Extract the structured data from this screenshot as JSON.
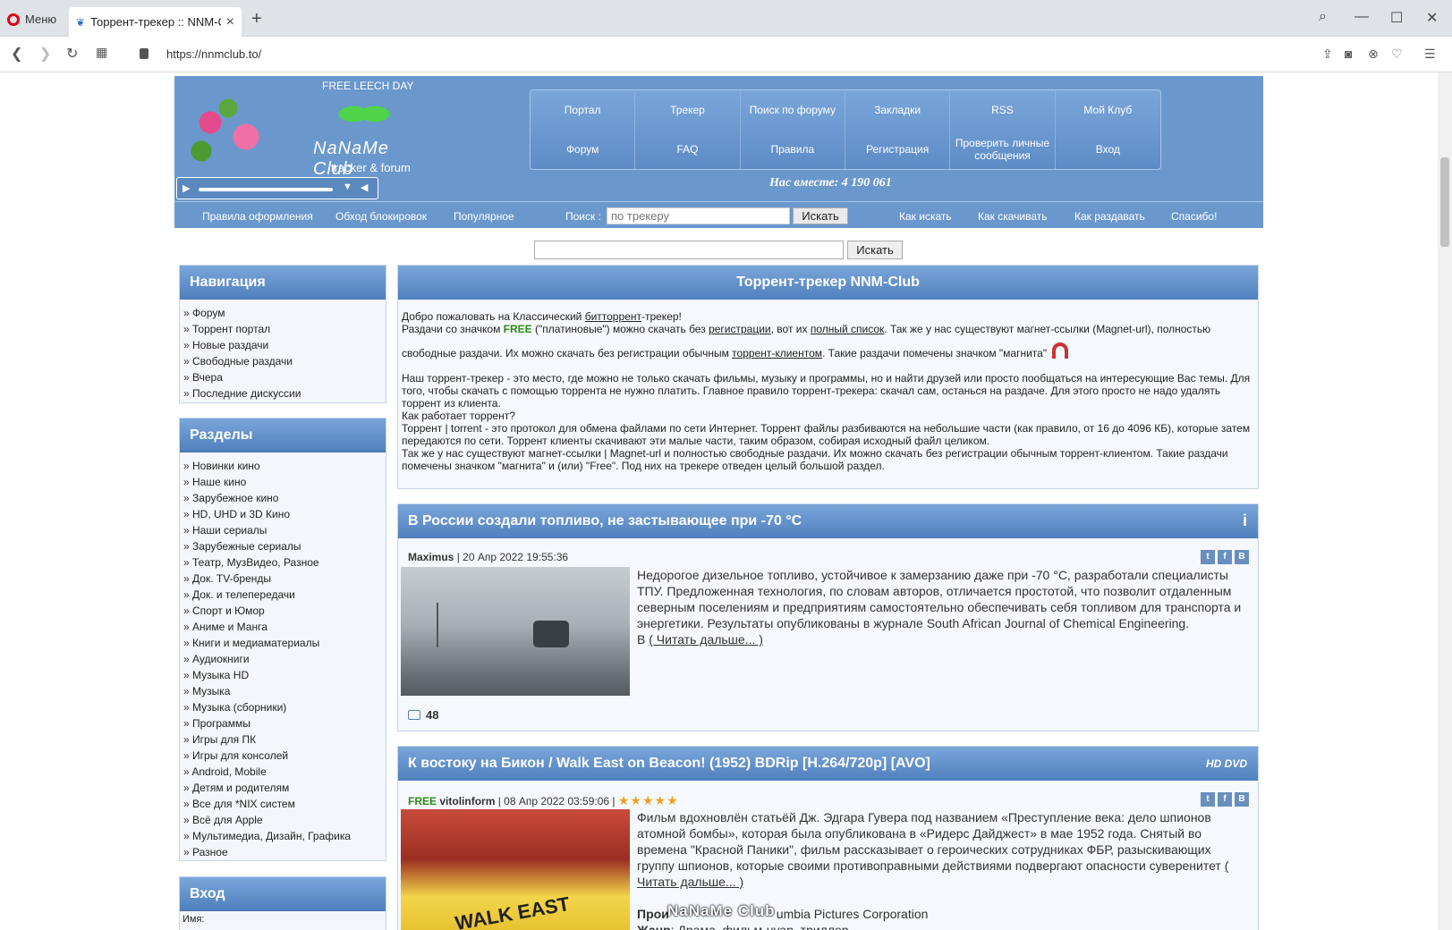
{
  "browser": {
    "menu_label": "Меню",
    "tab_title": "Торрент-трекер :: NNM-C",
    "url": "https://nnmclub.to/"
  },
  "header": {
    "free_leech": "FREE LEECH DAY",
    "site_name": "NaNaMe Club",
    "site_sub": "tracker & forum",
    "together": "Нас вместе: 4 190 061",
    "nav": [
      "Портал",
      "Трекер",
      "Поиск по форуму",
      "Закладки",
      "RSS",
      "Мой Клуб",
      "Форум",
      "FAQ",
      "Правила",
      "Регистрация",
      "Проверить личные сообщения",
      "Вход"
    ]
  },
  "subnav": {
    "links_left": [
      "Правила оформления",
      "Обход блокировок",
      "Популярное"
    ],
    "search_label": "Поиск :",
    "search_placeholder": "по трекеру",
    "search_button": "Искать",
    "links_right": [
      "Как искать",
      "Как скачивать",
      "Как раздавать",
      "Спасибо!"
    ]
  },
  "search2_button": "Искать",
  "sidebar": {
    "nav_title": "Навигация",
    "nav_items": [
      "Форум",
      "Торрент портал",
      "Новые раздачи",
      "Свободные раздачи",
      "Вчера",
      "Последние дискуссии"
    ],
    "sections_title": "Разделы",
    "sections": [
      "Новинки кино",
      "Наше кино",
      "Зарубежное кино",
      "HD, UHD и 3D Кино",
      "Наши сериалы",
      "Зарубежные сериалы",
      "Театр, МузВидео, Разное",
      "Док. TV-бренды",
      "Док. и телепередачи",
      "Спорт и Юмор",
      "Аниме и Манга",
      "Книги и медиаматериалы",
      "Аудиокниги",
      "Музыка HD",
      "Музыка",
      "Музыка (сборники)",
      "Программы",
      "Игры для ПК",
      "Игры для консолей",
      "Android, Mobile",
      "Детям и родителям",
      "Все для *NIX систем",
      "Всё для Apple",
      "Мультимедиа, Дизайн, Графика",
      "Разное"
    ],
    "login_title": "Вход",
    "login_name": "Имя:"
  },
  "welcome": {
    "title": "Торрент-трекер NNM-Club",
    "l1a": "Добро пожаловать на Классический ",
    "l1b": "битторрент",
    "l1c": "-трекер!",
    "l2a": "Раздачи со значком ",
    "free": "FREE",
    "l2b": " (\"платиновые\") можно скачать без ",
    "l2c": "регистрации",
    "l2d": ", вот их ",
    "l2e": "полный список",
    "l2f": ". Так же у нас существуют магнет-ссылки (Magnet-url), полностью",
    "l3a": "свободные раздачи. Их можно скачать без регистрации обычным ",
    "l3b": "торрент-клиентом",
    "l3c": ". Такие раздачи помечены значком \"магнита\"",
    "p2": "Наш торрент-трекер - это место, где можно не только скачать фильмы, музыку и программы, но и найти друзей или просто пообщаться на интересующие Вас темы. Для того, чтобы скачать с помощью торрента не нужно платить. Главное правило торрент-трекера: скачал сам, останься на раздаче. Для этого просто не надо удалять торрент из клиента.",
    "p3": "Как работает торрент?",
    "p4": "Торрент | torrent - это протокол для обмена файлами по сети Интернет. Торрент файлы разбиваются на небольшие части (как правило, от 16 до 4096 КБ), которые затем передаются по сети. Торрент клиенты скачивают эти малые части, таким образом, собирая исходный файл целиком.",
    "p5": "Так же у нас существуют магнет-ссылки | Magnet-url и полностью свободные раздачи. Их можно скачать без регистрации обычным торрент-клиентом. Такие раздачи помечены значком \"магнита\" и (или) \"Free\". Под них на трекере отведен целый большой раздел."
  },
  "news1": {
    "title": "В России создали топливо, не застывающее при -70 °C",
    "author": "Maximus",
    "date": " | 20 Апр 2022 19:55:36",
    "text": "Недорогое дизельное топливо, устойчивое к замерзанию даже при -70 °C, разработали специалисты ТПУ. Предложенная технология, по словам авторов, отличается простотой, что позволит отдаленным северным поселениям и предприятиям самостоятельно обеспечивать себя топливом для транспорта и энергетики. Результаты опубликованы в журнале South African Journal of Chemical Engineering.",
    "more_prefix": "В ",
    "more": "( Читать дальше... )",
    "comments": "48"
  },
  "news2": {
    "title": "К востоку на Бикон / Walk East on Beacon! (1952) BDRip [H.264/720p] [AVO]",
    "hd": "HD DVD",
    "free": "FREE",
    "author": "vitolinform",
    "date": " | 08 Апр 2022 03:59:06 | ",
    "stars": "★★★★★",
    "text": "Фильм вдохновлён статьёй Дж. Эдгара Гувера под названием «Преступление века: дело шпионов атомной бомбы», которая была опубликована в «Ридерс Дайджест» в мае 1952 года. Снятый во времена \"Красной Паники\", фильм рассказывает о героических сотрудниках ФБР, разыскивающих группу шпионов, которые своими противоправными действиями подвергают опасности суверенитет ",
    "more": "( Читать дальше... )",
    "prod_label": "Прои",
    "prod_value": "umbia Pictures Corporation",
    "genre_label": "Жанр",
    "genre_value": ": Драма, фильм-нуар, триллер",
    "poster_text": "WALK EAST"
  },
  "watermark": "NaNaMe Club"
}
